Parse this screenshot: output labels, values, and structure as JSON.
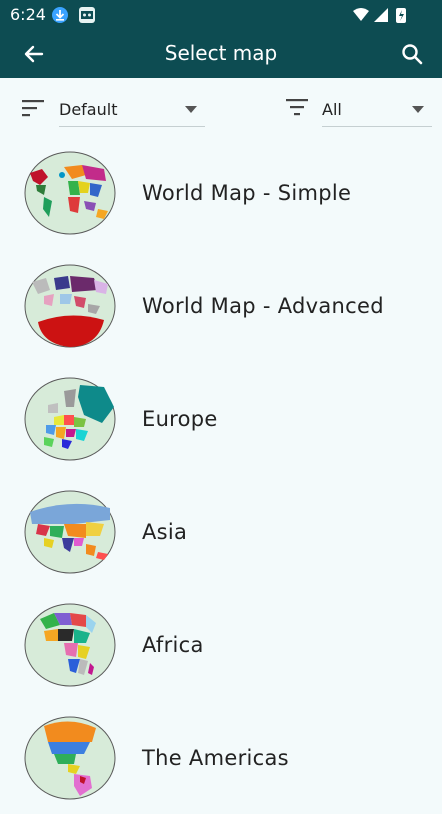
{
  "status": {
    "time": "6:24"
  },
  "header": {
    "title": "Select map"
  },
  "filters": {
    "sort_value": "Default",
    "filter_value": "All"
  },
  "maps": [
    {
      "label": "World Map - Simple"
    },
    {
      "label": "World Map - Advanced"
    },
    {
      "label": "Europe"
    },
    {
      "label": "Asia"
    },
    {
      "label": "Africa"
    },
    {
      "label": "The Americas"
    }
  ],
  "colors": {
    "appbar": "#0d4c52",
    "background": "#f3fafb",
    "globe": "#d7ebd9"
  }
}
